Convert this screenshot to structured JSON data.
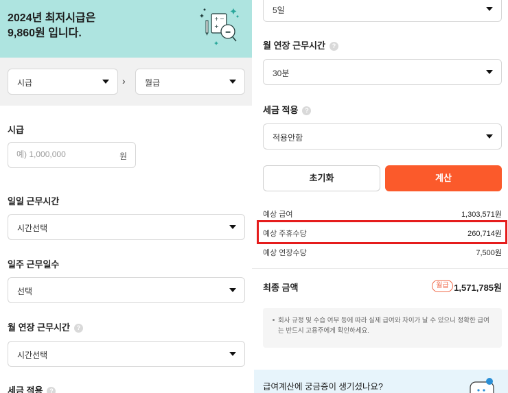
{
  "banner": {
    "title": "2024년 최저시급은\n9,860원 입니다."
  },
  "converter": {
    "from_label": "시급",
    "arrow": "›",
    "to_label": "월급"
  },
  "left_form": {
    "wage_label": "시급",
    "wage_placeholder": "예) 1,000,000",
    "wage_unit": "원",
    "daily_hours_label": "일일 근무시간",
    "daily_hours_value": "시간선택",
    "weekly_days_label": "일주 근무일수",
    "weekly_days_value": "선택",
    "overtime_label": "월 연장 근무시간",
    "overtime_value": "시간선택",
    "tax_label": "세금 적용",
    "help_glyph": "?"
  },
  "right_form": {
    "weekly_days_value": "5일",
    "overtime_label": "월 연장 근무시간",
    "overtime_value": "30분",
    "tax_label": "세금 적용",
    "tax_value": "적용안함",
    "reset_label": "초기화",
    "calc_label": "계산"
  },
  "results": {
    "rows": [
      {
        "label": "예상 급여",
        "value": "1,303,571원"
      },
      {
        "label": "예상 주휴수당",
        "value": "260,714원"
      },
      {
        "label": "예상 연장수당",
        "value": "7,500원"
      }
    ],
    "final_label": "최종 금액",
    "final_badge": "월급",
    "final_value": "1,571,785원"
  },
  "notice": {
    "text": "회사 규정 및 수습 여부 등에 따라 실제 급여와 차이가 날 수 있으니 정확한 급여는 반드시 고용주에게 확인하세요."
  },
  "inquiry": {
    "text": "급여계산에 궁금증이 생기셨나요?"
  },
  "colors": {
    "banner_bg": "#aee4e0",
    "accent": "#fb5a2b",
    "highlight_border": "#e51c1c",
    "badge": "#f06a4a"
  },
  "icons": [
    "calculator-illustration",
    "caret-down-icon",
    "help-icon",
    "chat-bot-icon"
  ]
}
